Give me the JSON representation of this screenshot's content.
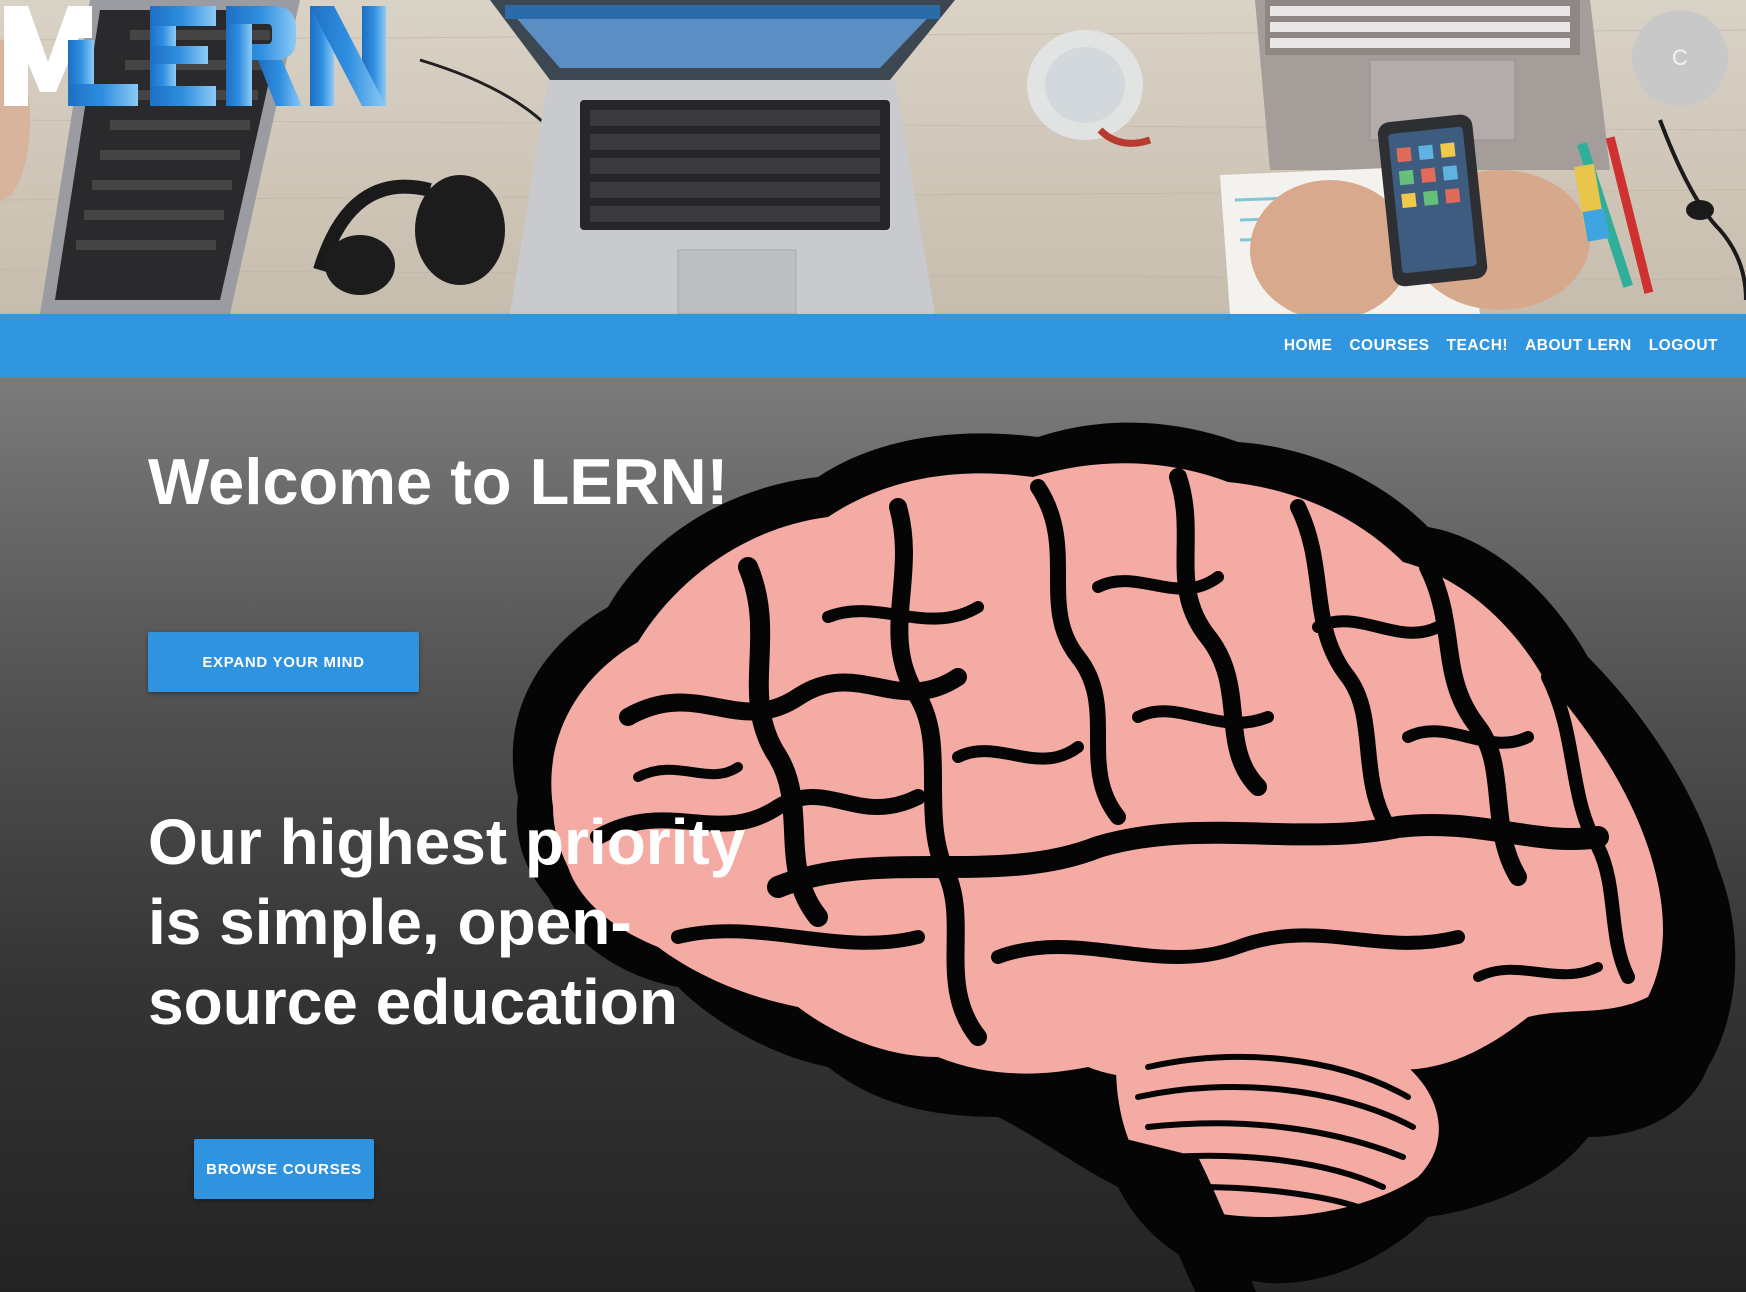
{
  "header": {
    "logo_text": "LERN",
    "avatar_initial": "C"
  },
  "nav": {
    "items": [
      {
        "label": "HOME"
      },
      {
        "label": "COURSES"
      },
      {
        "label": "TEACH!"
      },
      {
        "label": "ABOUT LERN"
      },
      {
        "label": "LOGOUT"
      }
    ]
  },
  "hero": {
    "title": "Welcome to LERN!",
    "cta_primary": "EXPAND YOUR MIND",
    "subtitle": "Our highest priority is simple, open-source education",
    "cta_secondary": "BROWSE COURSES"
  },
  "colors": {
    "primary": "#3096e0",
    "brain_pink": "#f4aba3",
    "avatar_gray": "#c8c8c8"
  }
}
